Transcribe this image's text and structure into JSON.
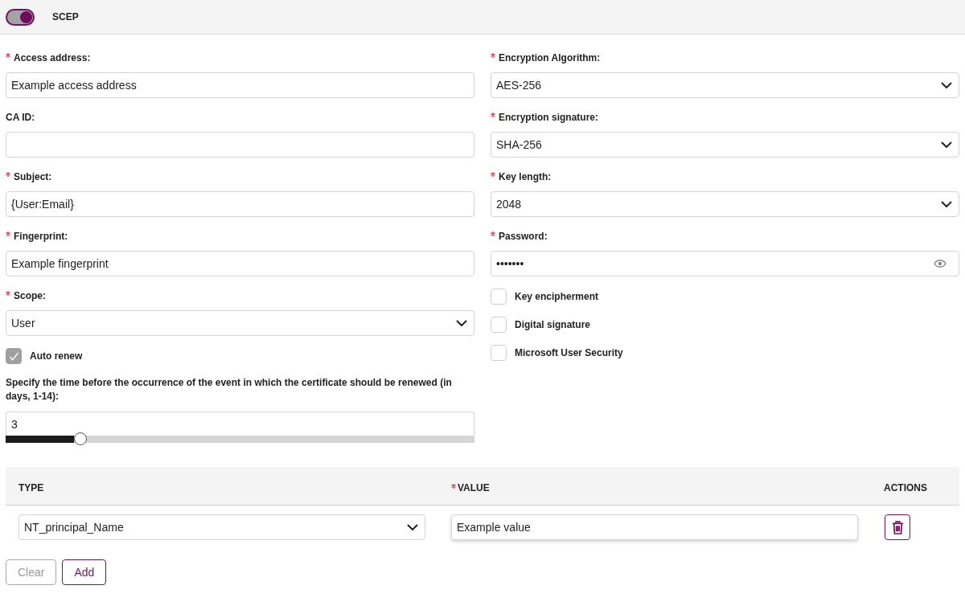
{
  "header": {
    "toggle": {
      "on": true
    },
    "title": "SCEP"
  },
  "left_fields": [
    {
      "kind": "text",
      "label": "Access address:",
      "required": true,
      "value": "Example access address"
    },
    {
      "kind": "text",
      "label": "CA ID:",
      "required": false
    },
    {
      "kind": "text",
      "label": "Subject:",
      "required": true,
      "value": "{User:Email}"
    },
    {
      "kind": "text",
      "label": "Fingerprint:",
      "required": true,
      "value": "Example fingerprint"
    },
    {
      "kind": "select",
      "label": "Scope:",
      "required": true,
      "value": "User"
    }
  ],
  "auto_renew": {
    "label": "Auto renew",
    "checked": true
  },
  "renewal": {
    "label": "Specify the time before the occurrence of the event in which the certificate should be renewed (in days, 1-14):",
    "value": "3",
    "level": 0.16
  },
  "right_fields": [
    {
      "kind": "select",
      "label": "Encryption Algorithm:",
      "required": true,
      "value": "AES-256"
    },
    {
      "kind": "select",
      "label": "Encryption signature:",
      "required": true,
      "value": "SHA-256"
    },
    {
      "kind": "select",
      "label": "Key length:",
      "required": true,
      "value": "2048"
    },
    {
      "kind": "password",
      "label": "Password:",
      "required": true,
      "value": "•••••••"
    }
  ],
  "options": [
    {
      "label": "Key encipherment",
      "checked": false
    },
    {
      "label": "Digital signature",
      "checked": false
    },
    {
      "label": "Microsoft User Security",
      "checked": false
    }
  ],
  "table": {
    "columns": [
      {
        "label": "TYPE",
        "required": false
      },
      {
        "label": "VALUE",
        "required": true
      },
      {
        "label": "ACTIONS",
        "required": false
      }
    ],
    "rows": [
      {
        "type": "NT_principal_Name",
        "value": "Example value"
      }
    ]
  },
  "buttons": [
    {
      "label": "Clear",
      "disabled": true
    },
    {
      "label": "Add",
      "disabled": false
    }
  ]
}
